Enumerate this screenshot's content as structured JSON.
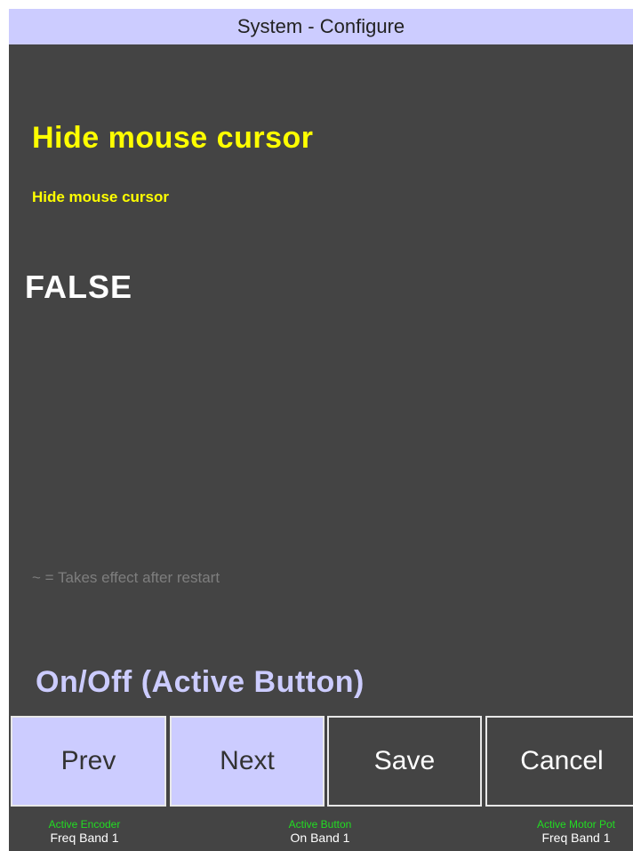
{
  "window": {
    "title": "System - Configure"
  },
  "setting": {
    "heading": "Hide mouse cursor",
    "description": "Hide mouse cursor",
    "value": "FALSE"
  },
  "note": "~ = Takes effect after restart",
  "active_button_label": "On/Off (Active Button)",
  "buttons": {
    "prev": "Prev",
    "next": "Next",
    "save": "Save",
    "cancel": "Cancel"
  },
  "status": {
    "encoder": {
      "label": "Active Encoder",
      "value": "Freq Band 1"
    },
    "button": {
      "label": "Active Button",
      "value": "On Band 1"
    },
    "motor_pot": {
      "label": "Active Motor Pot",
      "value": "Freq Band 1"
    }
  },
  "colors": {
    "background": "#444444",
    "title_bar": "#ccccff",
    "heading": "#ffff00",
    "value": "#ffffff",
    "status_label": "#22dd22"
  }
}
